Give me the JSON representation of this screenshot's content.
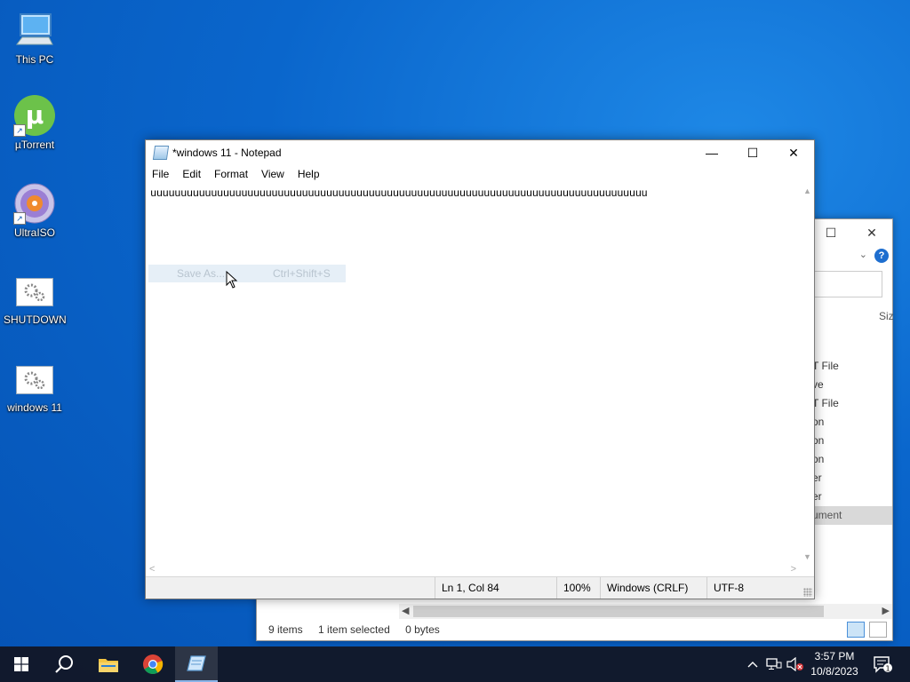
{
  "desktop": {
    "icons": [
      {
        "label": "This PC",
        "icon": "this-pc-icon"
      },
      {
        "label": "µTorrent",
        "icon": "utorrent-icon"
      },
      {
        "label": "UltraISO",
        "icon": "ultraiso-icon"
      },
      {
        "label": "SHUTDOWN",
        "icon": "settings-file-icon"
      },
      {
        "label": "windows 11",
        "icon": "settings-file-icon"
      }
    ]
  },
  "explorer": {
    "col_size": "Siz",
    "types": [
      "T File",
      "ve",
      "T File",
      "on",
      "on",
      "on",
      "er",
      "er",
      "ument"
    ],
    "status": {
      "items": "9 items",
      "selected": "1 item selected",
      "size": "0 bytes"
    },
    "help": "?"
  },
  "notepad": {
    "title": "*windows 11 - Notepad",
    "menu": [
      "File",
      "Edit",
      "Format",
      "View",
      "Help"
    ],
    "content": "uuuuuuuuuuuuuuuuuuuuuuuuuuuuuuuuuuuuuuuuuuuuuuuuuuuuuuuuuuuuuuuuuuuuuuuuuuuuuuuuuu",
    "status": {
      "position": "Ln 1, Col 84",
      "zoom": "100%",
      "line_ending": "Windows (CRLF)",
      "encoding": "UTF-8"
    }
  },
  "ghost_menu": {
    "label": "Save As...",
    "shortcut": "Ctrl+Shift+S"
  },
  "taskbar": {
    "time": "3:57 PM",
    "date": "10/8/2023",
    "notification_count": "1"
  }
}
